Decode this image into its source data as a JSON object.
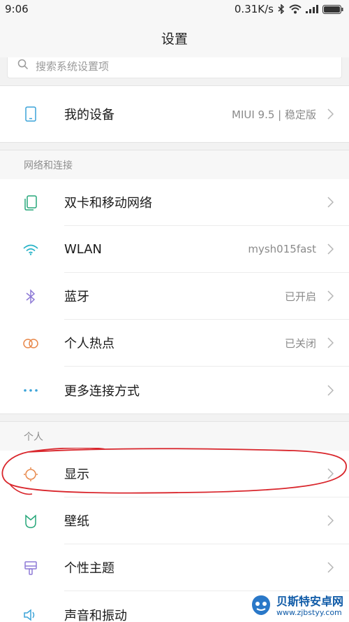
{
  "status": {
    "time": "9:06",
    "speed": "0.31K/s"
  },
  "header": {
    "title": "设置"
  },
  "search": {
    "placeholder": "搜索系统设置项",
    "icon": "search-icon"
  },
  "device": {
    "label": "我的设备",
    "value": "MIUI 9.5 | 稳定版",
    "icon": "phone-icon"
  },
  "sections": {
    "network": {
      "title": "网络和连接",
      "items": [
        {
          "label": "双卡和移动网络",
          "value": "",
          "icon": "dual-sim-icon"
        },
        {
          "label": "WLAN",
          "value": "mysh015fast",
          "icon": "wifi-icon"
        },
        {
          "label": "蓝牙",
          "value": "已开启",
          "icon": "bluetooth-icon"
        },
        {
          "label": "个人热点",
          "value": "已关闭",
          "icon": "hotspot-icon"
        },
        {
          "label": "更多连接方式",
          "value": "",
          "icon": "more-dots-icon"
        }
      ]
    },
    "personal": {
      "title": "个人",
      "items": [
        {
          "label": "显示",
          "value": "",
          "icon": "display-icon"
        },
        {
          "label": "壁纸",
          "value": "",
          "icon": "wallpaper-icon"
        },
        {
          "label": "个性主题",
          "value": "",
          "icon": "theme-icon"
        },
        {
          "label": "声音和振动",
          "value": "",
          "icon": "sound-icon"
        }
      ]
    }
  },
  "annotation": {
    "color": "#d9262c"
  },
  "watermark": {
    "title": "贝斯特安卓网",
    "url": "www.zjbstyy.com"
  },
  "colors": {
    "accent_blue": "#3ba3d8",
    "accent_green": "#27a77a",
    "accent_orange": "#e8884a",
    "accent_purple": "#8e7ad6"
  }
}
